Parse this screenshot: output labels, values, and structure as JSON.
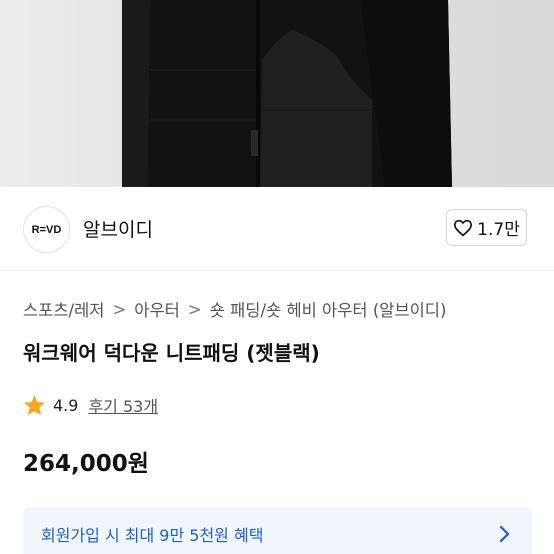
{
  "brand": {
    "logo_text": "R=VD",
    "name": "알브이디",
    "like_count": "1.7만"
  },
  "breadcrumb": [
    "스포츠/레저",
    "아우터",
    "숏 패딩/숏 헤비 아우터 (알브이디)"
  ],
  "product": {
    "title": "워크웨어 덕다운 니트패딩 (젯블랙)",
    "rating": "4.9",
    "reviews_label": "후기 53개",
    "price": "264,000원"
  },
  "benefit": {
    "text": "회원가입 시 최대 9만 5천원 혜택"
  },
  "colors": {
    "star": "#f5a623",
    "benefit_text": "#1f5fd6",
    "benefit_bg": "#f1f5fc"
  },
  "icons": {
    "heart": "heart-outline-icon",
    "star": "star-filled-icon",
    "chevron": "chevron-right-icon"
  }
}
